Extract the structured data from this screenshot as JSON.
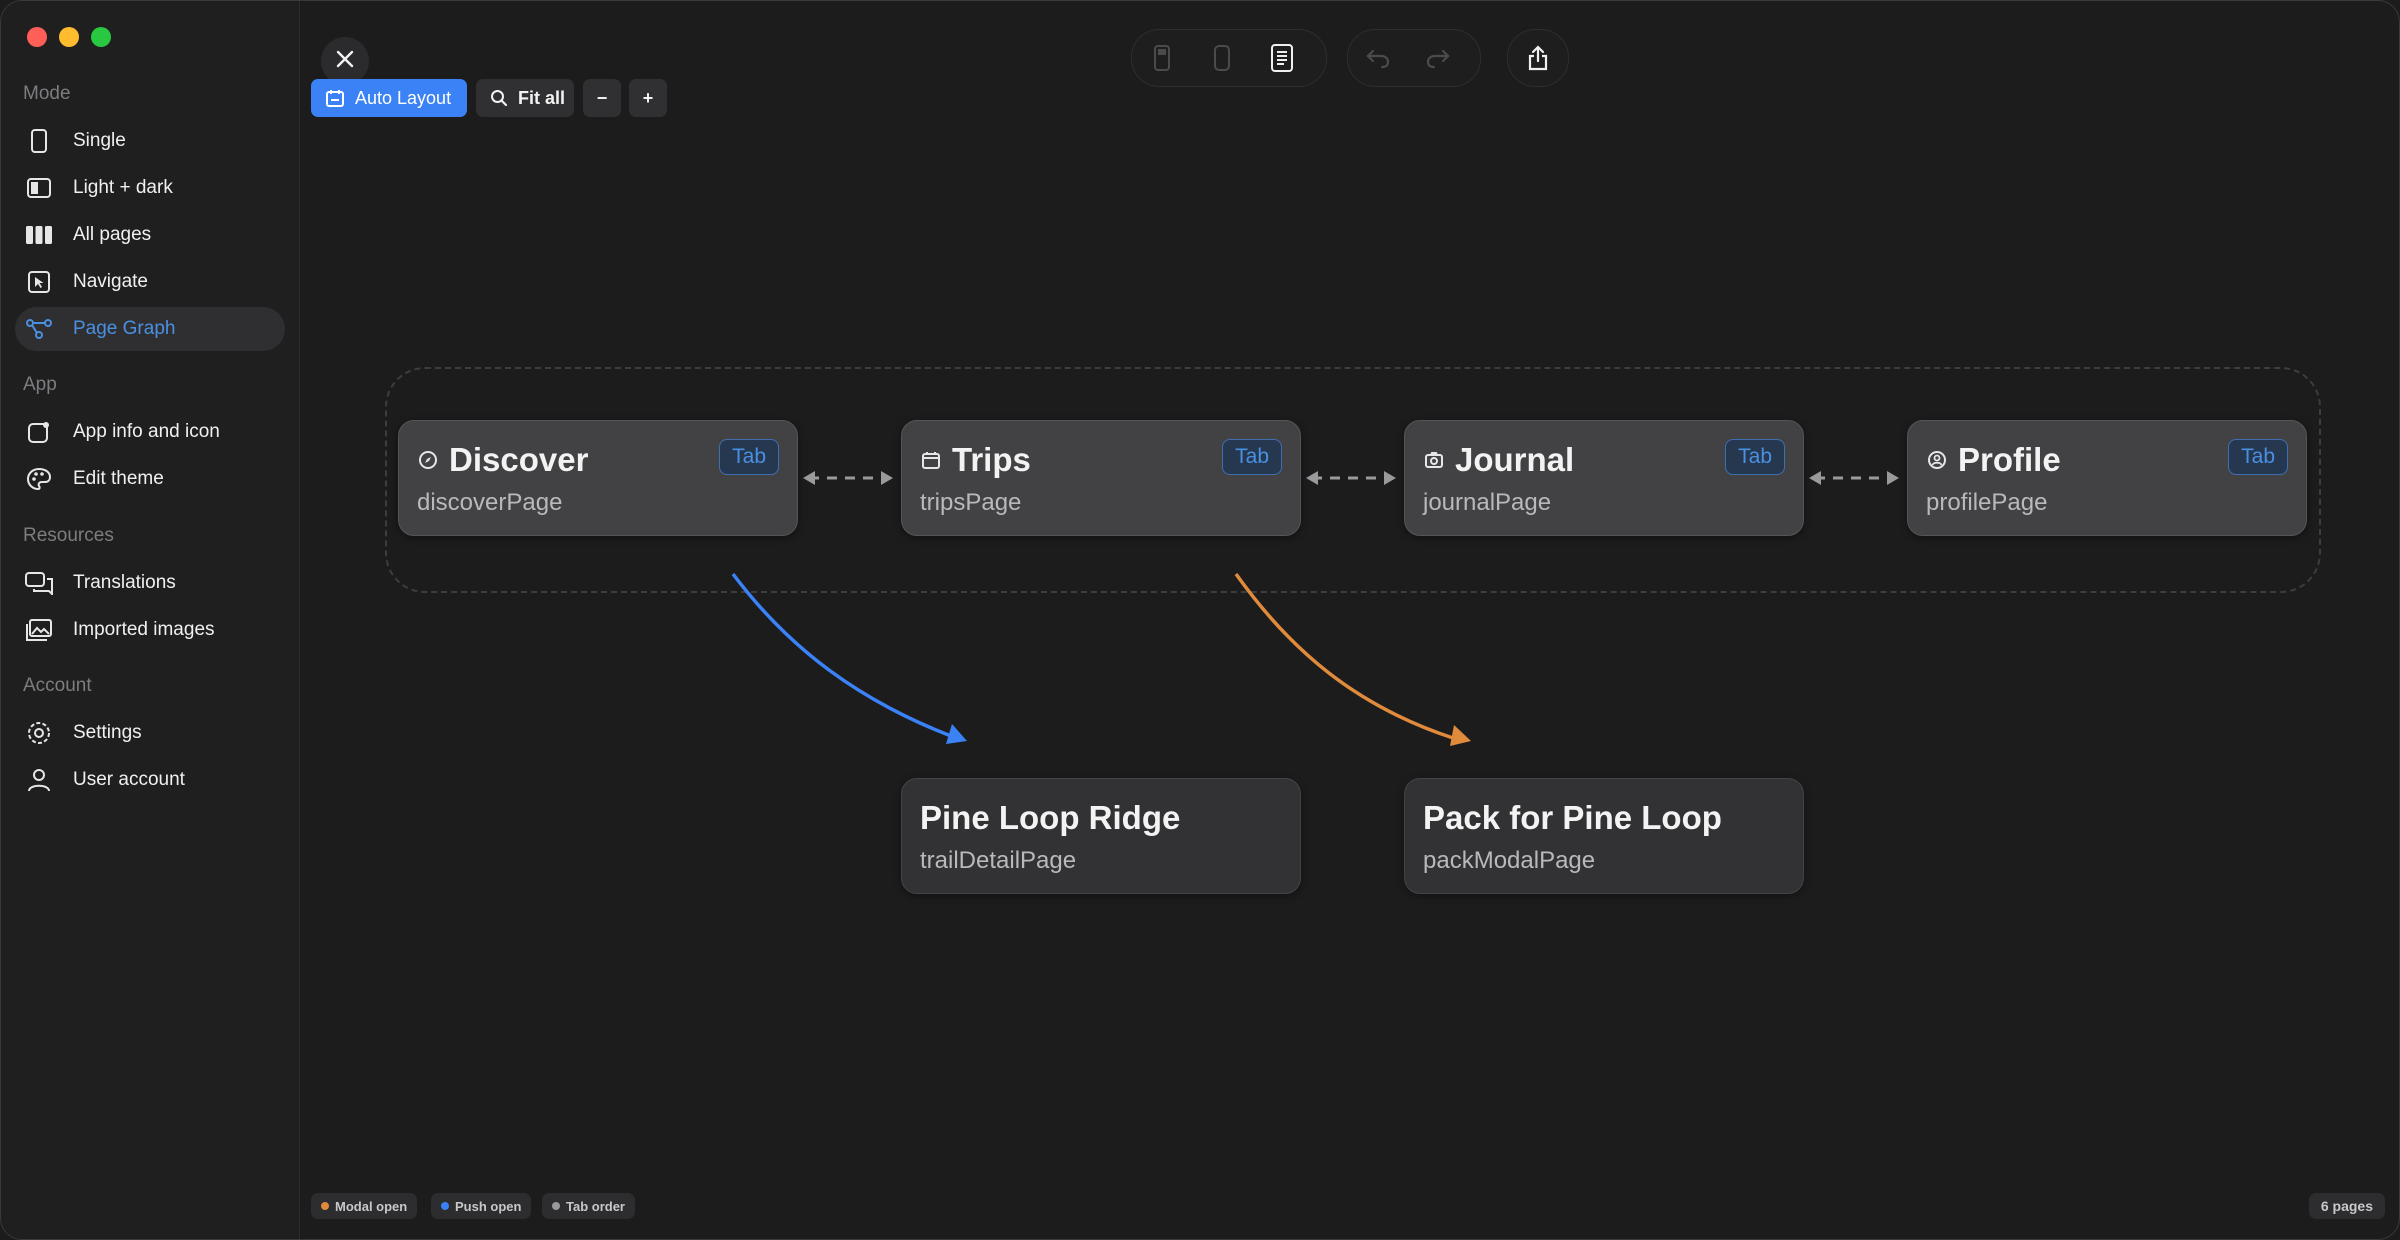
{
  "sidebar": {
    "sections": [
      {
        "label": "Mode"
      },
      {
        "label": "App"
      },
      {
        "label": "Resources"
      },
      {
        "label": "Account"
      }
    ],
    "items": [
      {
        "label": "Single",
        "icon": "phone-icon"
      },
      {
        "label": "Light + dark",
        "icon": "split-theme-icon"
      },
      {
        "label": "All pages",
        "icon": "columns-icon"
      },
      {
        "label": "Navigate",
        "icon": "cursor-icon"
      },
      {
        "label": "Page Graph",
        "icon": "graph-icon",
        "active": true
      },
      {
        "label": "App info and icon",
        "icon": "app-icon"
      },
      {
        "label": "Edit theme",
        "icon": "palette-icon"
      },
      {
        "label": "Translations",
        "icon": "chat-icon"
      },
      {
        "label": "Imported images",
        "icon": "images-icon"
      },
      {
        "label": "Settings",
        "icon": "gear-icon"
      },
      {
        "label": "User account",
        "icon": "person-icon"
      }
    ]
  },
  "toolbar": {
    "auto_layout": "Auto Layout",
    "fit_all": "Fit all",
    "zoom_out": "−",
    "zoom_in": "+"
  },
  "graph": {
    "nodes": [
      {
        "title": "Discover",
        "subtitle": "discoverPage",
        "badge": "Tab",
        "icon": "compass-icon"
      },
      {
        "title": "Trips",
        "subtitle": "tripsPage",
        "badge": "Tab",
        "icon": "calendar-icon"
      },
      {
        "title": "Journal",
        "subtitle": "journalPage",
        "badge": "Tab",
        "icon": "camera-icon"
      },
      {
        "title": "Profile",
        "subtitle": "profilePage",
        "badge": "Tab",
        "icon": "person-circle-icon"
      },
      {
        "title": "Pine Loop Ridge",
        "subtitle": "trailDetailPage"
      },
      {
        "title": "Pack for Pine Loop",
        "subtitle": "packModalPage"
      }
    ],
    "edges": [
      {
        "from": "Discover",
        "to": "Pine Loop Ridge",
        "kind": "Push open",
        "color": "#3b82f6"
      },
      {
        "from": "Trips",
        "to": "Pack for Pine Loop",
        "kind": "Modal open",
        "color": "#e08a3c"
      }
    ]
  },
  "legend": [
    {
      "label": "Modal open",
      "color": "#e08a3c"
    },
    {
      "label": "Push open",
      "color": "#3b82f6"
    },
    {
      "label": "Tab order",
      "color": "#9a9a9c"
    }
  ],
  "page_count": "6 pages"
}
